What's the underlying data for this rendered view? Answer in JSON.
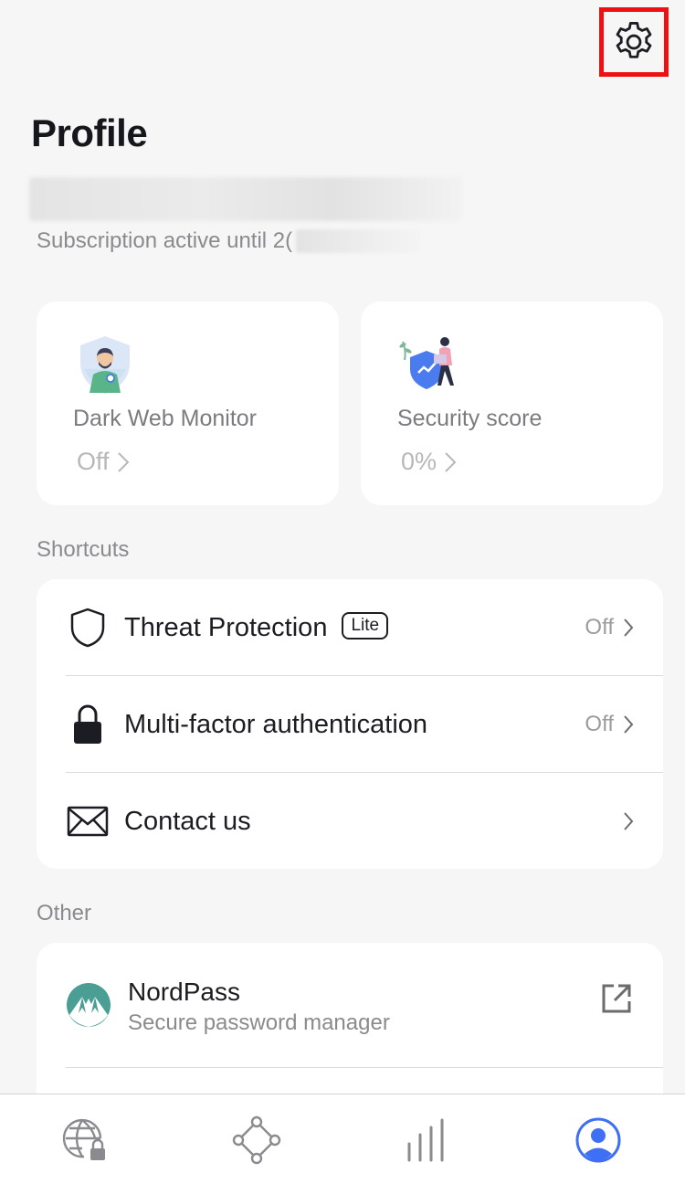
{
  "header": {
    "title": "Profile",
    "settings_icon": "gear-icon",
    "highlight_color": "#ee1111"
  },
  "account": {
    "subscription_prefix": "Subscription active until 2("
  },
  "cards": [
    {
      "label": "Dark Web Monitor",
      "value": "Off",
      "icon": "dark-web-monitor-illustration"
    },
    {
      "label": "Security score",
      "value": "0%",
      "icon": "security-score-illustration"
    }
  ],
  "shortcuts": {
    "section_label": "Shortcuts",
    "items": [
      {
        "label": "Threat Protection",
        "badge": "Lite",
        "status": "Off",
        "icon": "shield-icon"
      },
      {
        "label": "Multi-factor authentication",
        "status": "Off",
        "icon": "lock-icon"
      },
      {
        "label": "Contact us",
        "icon": "envelope-icon"
      }
    ]
  },
  "other": {
    "section_label": "Other",
    "items": [
      {
        "title": "NordPass",
        "subtitle": "Secure password manager",
        "icon": "nordpass-logo-icon",
        "action_icon": "external-link-icon"
      }
    ]
  },
  "bottom_nav": {
    "items": [
      {
        "icon": "globe-lock-icon",
        "active": false
      },
      {
        "icon": "meshnet-icon",
        "active": false
      },
      {
        "icon": "stats-bars-icon",
        "active": false
      },
      {
        "icon": "profile-icon",
        "active": true
      }
    ],
    "active_color": "#3e6ff4",
    "inactive_color": "#8a8a8f"
  }
}
